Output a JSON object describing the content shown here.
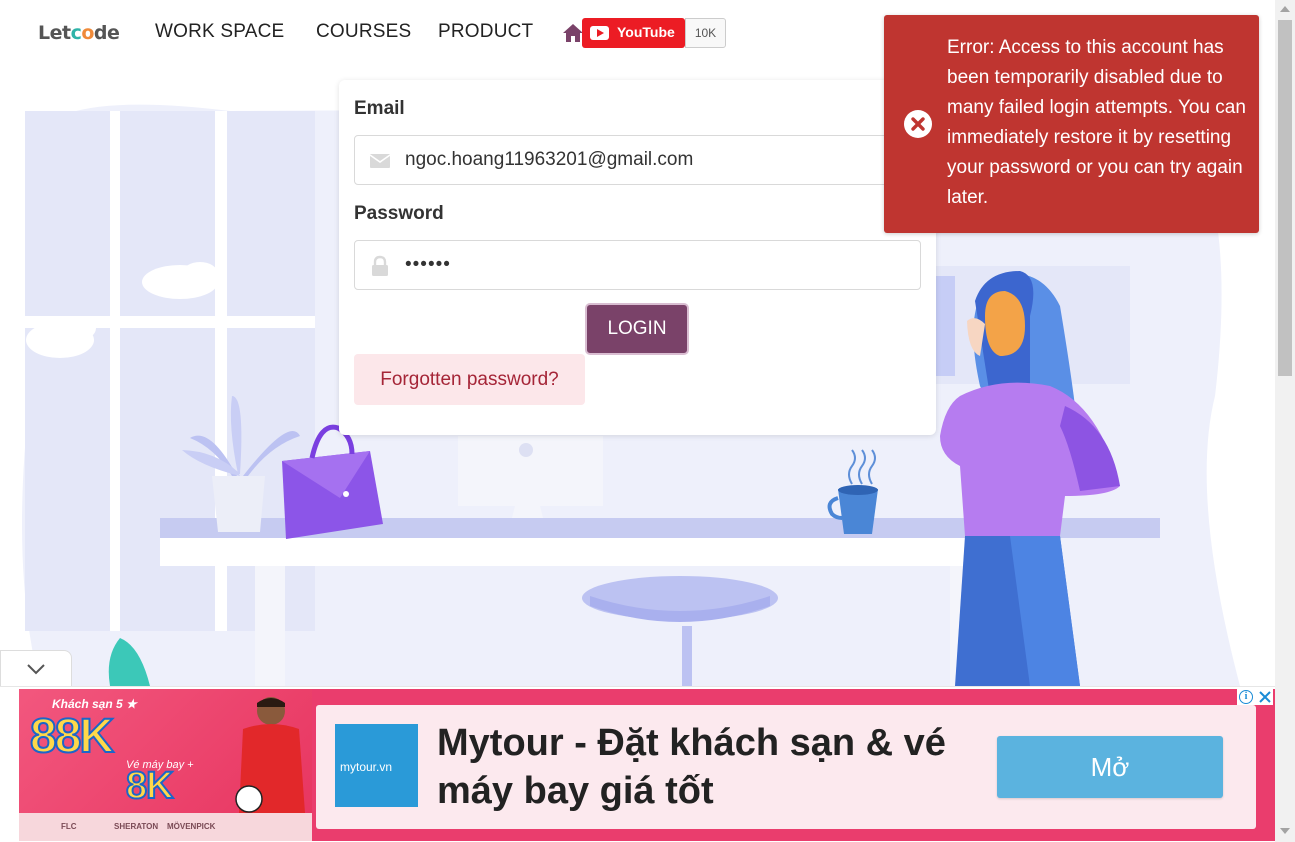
{
  "nav": {
    "logo_prefix": "Let",
    "logo_o1": "c",
    "logo_o2": "o",
    "logo_suffix": "de",
    "links": [
      "WORK SPACE",
      "COURSES",
      "PRODUCT"
    ],
    "home_icon": "home-icon",
    "youtube_label": "YouTube",
    "youtube_count": "10K"
  },
  "login": {
    "email_label": "Email",
    "email_value": "ngoc.hoang11963201@gmail.com",
    "email_icon": "envelope-icon",
    "password_label": "Password",
    "password_value": "••••••",
    "password_icon": "lock-icon",
    "login_button": "LOGIN",
    "forgot_button": "Forgotten password?"
  },
  "toast": {
    "icon": "error-circle-icon",
    "message": "Error: Access to this account has been temporarily disabled due to many failed login attempts. You can immediately restore it by resetting your password or you can try again later.",
    "color": "#bf3530"
  },
  "ad": {
    "promo_line1": "Khách sạn 5 ★",
    "promo_big1": "88K",
    "promo_line2": "Vé máy bay +",
    "promo_big2": "8K",
    "brands": [
      "FLC",
      "SHERATON",
      "MÖVENPICK"
    ],
    "logo_text": "mytour.vn",
    "title": "Mytour - Đặt khách sạn & vé máy bay giá tốt",
    "cta": "Mở",
    "info_icon": "ad-info-icon",
    "close_icon": "ad-close-icon"
  },
  "colors": {
    "primary_button": "#7a4269",
    "forgot_bg": "#fce7ea",
    "ad_cta": "#5bb3df"
  }
}
